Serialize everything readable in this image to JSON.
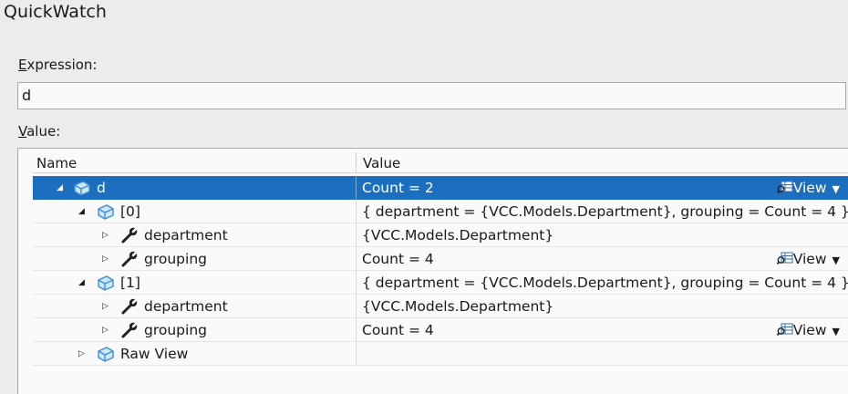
{
  "window": {
    "title": "QuickWatch"
  },
  "expression": {
    "label_rest": "xpression:",
    "label_mnemonic": "E",
    "value": "d"
  },
  "value_section": {
    "label_rest": "alue:",
    "label_mnemonic": "V"
  },
  "grid": {
    "columns": [
      "Name",
      "Value"
    ],
    "view_label": "View",
    "rows": [
      {
        "name": "d",
        "value": "Count = 2",
        "expanded": true,
        "icon": "object-cube-icon",
        "has_view": true,
        "selected": true
      },
      {
        "name": "[0]",
        "value": "{ department = {VCC.Models.Department}, grouping = Count = 4 }",
        "expanded": true,
        "icon": "object-cube-icon"
      },
      {
        "name": "department",
        "value": "{VCC.Models.Department}",
        "expanded": false,
        "icon": "wrench-property-icon"
      },
      {
        "name": "grouping",
        "value": "Count = 4",
        "expanded": false,
        "icon": "wrench-property-icon",
        "has_view": true
      },
      {
        "name": "[1]",
        "value": "{ department = {VCC.Models.Department}, grouping = Count = 4 }",
        "expanded": true,
        "icon": "object-cube-icon"
      },
      {
        "name": "department",
        "value": "{VCC.Models.Department}",
        "expanded": false,
        "icon": "wrench-property-icon"
      },
      {
        "name": "grouping",
        "value": "Count = 4",
        "expanded": false,
        "icon": "wrench-property-icon",
        "has_view": true
      },
      {
        "name": "Raw View",
        "value": "",
        "expanded": false,
        "icon": "object-cube-icon"
      }
    ]
  },
  "colors": {
    "selection": "#1c6fbf",
    "cube": "#3c8fd6",
    "wrench": "#222222"
  }
}
